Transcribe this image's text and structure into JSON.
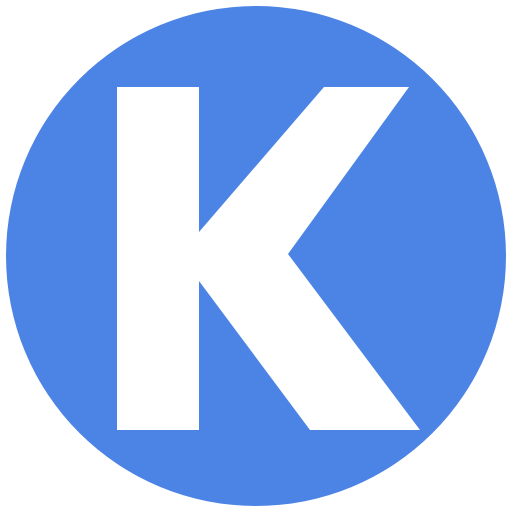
{
  "icon": {
    "name": "k-letter-icon",
    "letter": "K",
    "colors": {
      "circle": "#4C84E6",
      "letter": "#FFFFFF",
      "background": "#FFFFFF"
    }
  }
}
